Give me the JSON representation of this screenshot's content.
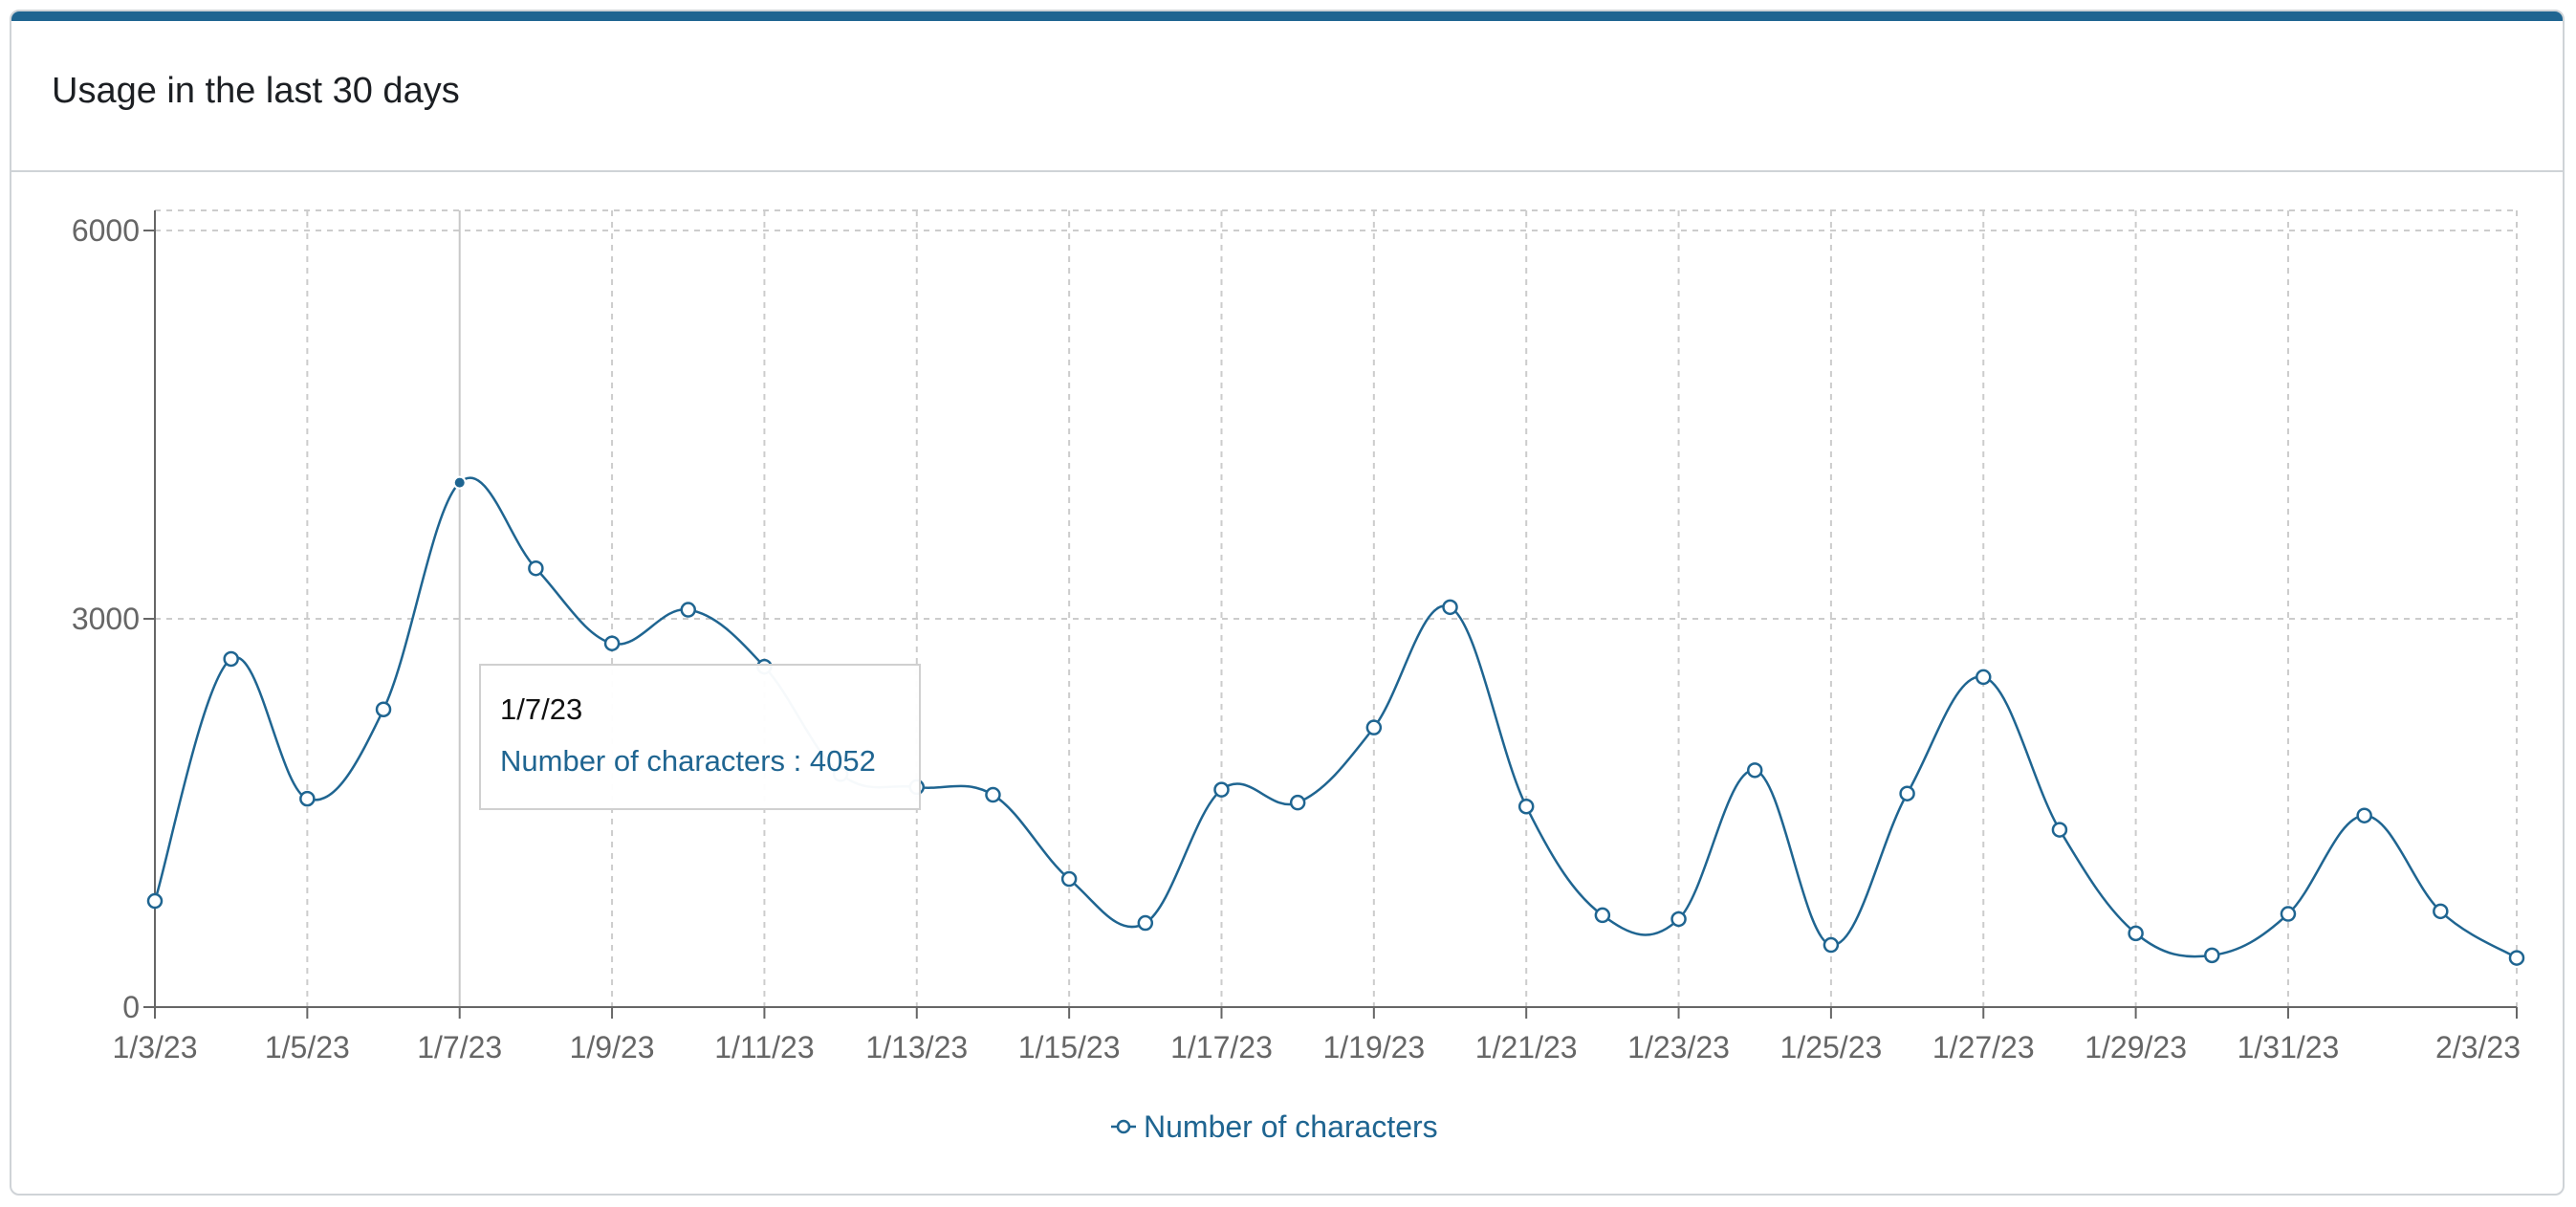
{
  "header": {
    "title": "Usage in the last 30 days"
  },
  "colors": {
    "series": "#1f6591",
    "accent_bar": "#1f6591",
    "grid": "#cccccc",
    "axis": "#666666"
  },
  "tooltip": {
    "label": "1/7/23",
    "item_text": "Number of characters : 4052"
  },
  "chart_data": {
    "type": "line",
    "title": "",
    "xlabel": "",
    "ylabel": "",
    "ylim": [
      0,
      6000
    ],
    "yticks": [
      0,
      3000,
      6000
    ],
    "grid": true,
    "legend": "bottom-center",
    "x": [
      "1/3/23",
      "1/4/23",
      "1/5/23",
      "1/6/23",
      "1/7/23",
      "1/8/23",
      "1/9/23",
      "1/10/23",
      "1/11/23",
      "1/12/23",
      "1/13/23",
      "1/14/23",
      "1/15/23",
      "1/16/23",
      "1/17/23",
      "1/18/23",
      "1/19/23",
      "1/20/23",
      "1/21/23",
      "1/22/23",
      "1/23/23",
      "1/24/23",
      "1/25/23",
      "1/26/23",
      "1/27/23",
      "1/28/23",
      "1/29/23",
      "1/30/23",
      "1/31/23",
      "2/1/23",
      "2/2/23",
      "2/3/23"
    ],
    "xtick_labels": [
      "1/3/23",
      "1/5/23",
      "1/7/23",
      "1/9/23",
      "1/11/23",
      "1/13/23",
      "1/15/23",
      "1/17/23",
      "1/19/23",
      "1/21/23",
      "1/23/23",
      "1/25/23",
      "1/27/23",
      "1/29/23",
      "1/31/23",
      "2/3/23"
    ],
    "series": [
      {
        "name": "Number of characters",
        "values": [
          820,
          2690,
          1610,
          2300,
          4052,
          3390,
          2810,
          3070,
          2630,
          1800,
          1700,
          1640,
          990,
          650,
          1680,
          1580,
          2160,
          3090,
          1550,
          710,
          680,
          1830,
          480,
          1650,
          2550,
          1370,
          570,
          400,
          720,
          1480,
          740,
          380
        ]
      }
    ],
    "active_point": "1/7/23"
  }
}
